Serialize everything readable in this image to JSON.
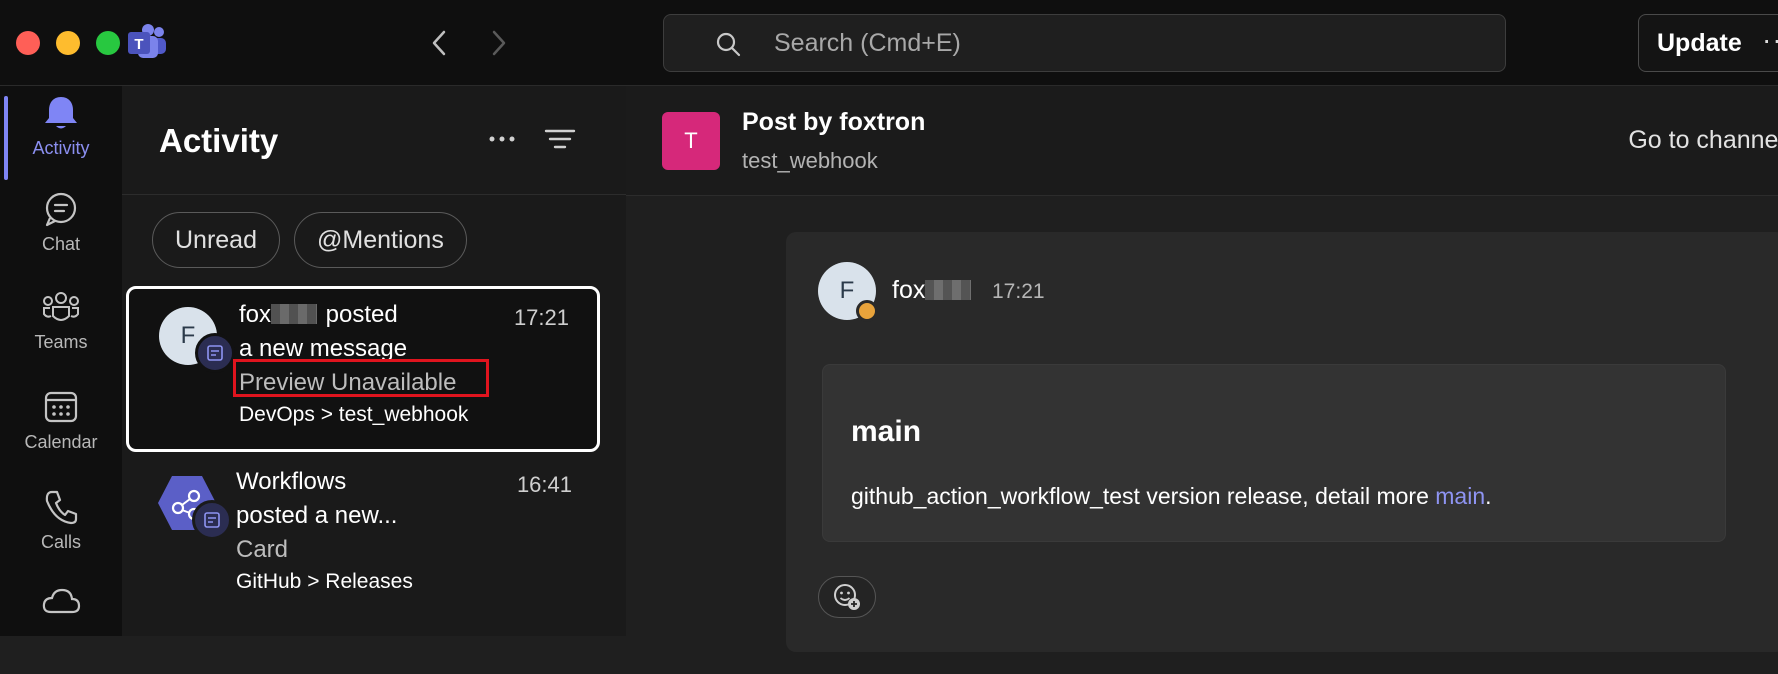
{
  "search": {
    "placeholder": "Search (Cmd+E)"
  },
  "titlebar": {
    "update_label": "Update",
    "more_glyph": "··"
  },
  "rail": {
    "items": [
      {
        "label": "Activity",
        "icon": "bell-icon",
        "active": true
      },
      {
        "label": "Chat",
        "icon": "chat-icon"
      },
      {
        "label": "Teams",
        "icon": "teams-icon"
      },
      {
        "label": "Calendar",
        "icon": "calendar-icon"
      },
      {
        "label": "Calls",
        "icon": "phone-icon"
      },
      {
        "label": "",
        "icon": "cloud-icon"
      }
    ]
  },
  "activity": {
    "title": "Activity",
    "filters": [
      "Unread",
      "@Mentions"
    ],
    "feed": [
      {
        "avatar_initial": "F",
        "author_prefix": "fox",
        "line1_suffix": " posted",
        "line2": "a new message",
        "preview": "Preview Unavailable",
        "path": "DevOps > test_webhook",
        "time": "17:21"
      },
      {
        "author": "Workflows",
        "line2": "posted a new...",
        "preview": "Card",
        "path": "GitHub > Releases",
        "time": "16:41"
      }
    ]
  },
  "conversation": {
    "avatar_initial": "T",
    "title": "Post by foxtron",
    "channel": "test_webhook",
    "goto_label": "Go to channel",
    "message": {
      "avatar_initial": "F",
      "author_prefix": "fox",
      "time": "17:21",
      "card": {
        "title": "main",
        "body_text": "github_action_workflow_test version release, detail more ",
        "link_text": "main",
        "body_suffix": "."
      }
    }
  },
  "colors": {
    "accent": "#7f85f5",
    "link": "#8e94f2",
    "highlight": "#e0141e",
    "channel_avatar": "#d6287a",
    "status_away": "#e8a33b"
  }
}
